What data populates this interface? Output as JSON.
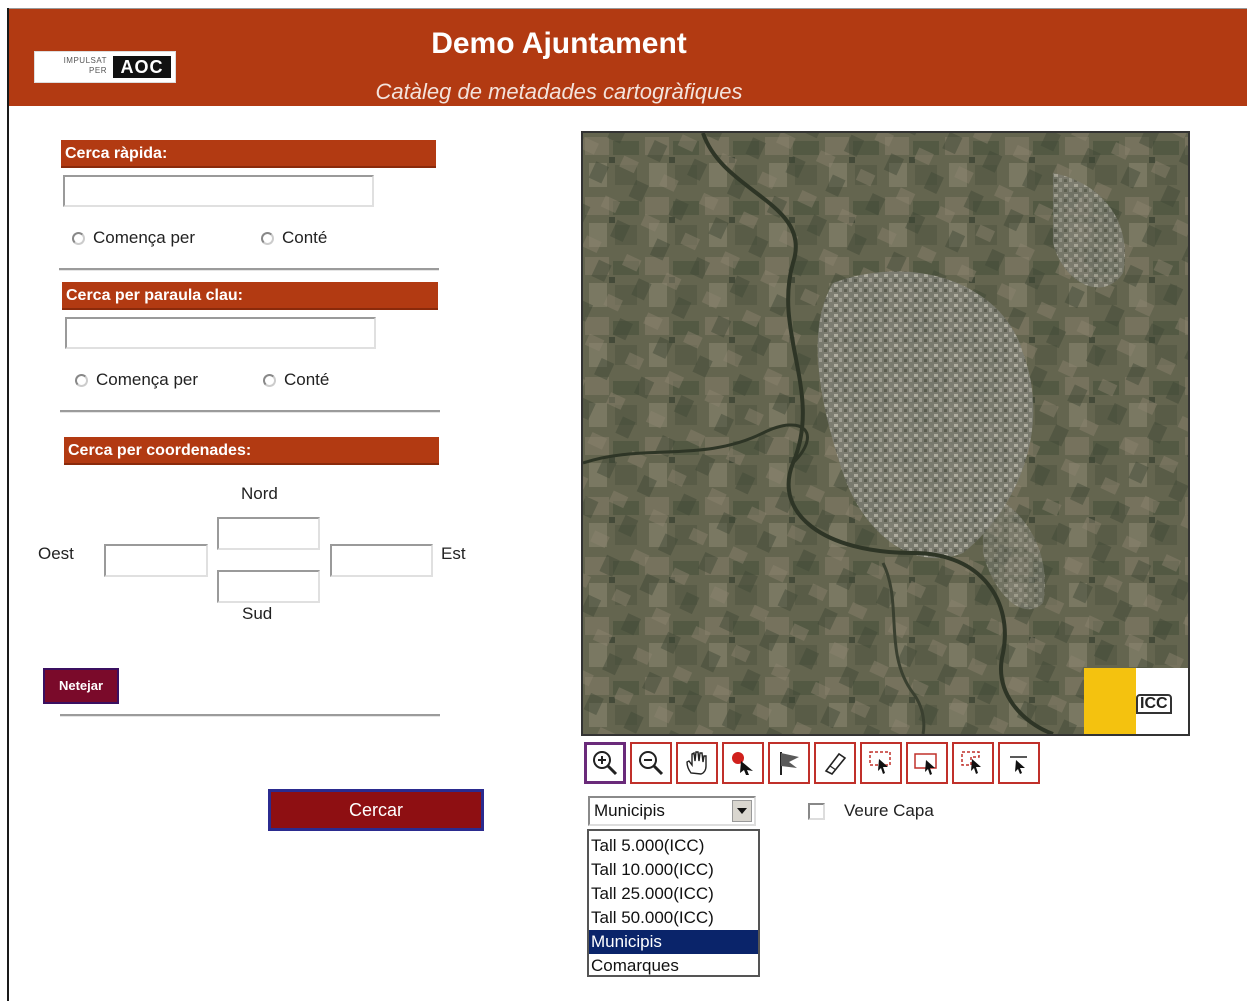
{
  "header": {
    "title": "Demo Ajuntament",
    "subtitle": "Catàleg de metadades cartogràfiques",
    "logo": {
      "small_text_1": "IMPULSAT",
      "small_text_2": "PER",
      "brand": "AOC"
    }
  },
  "quick_search": {
    "heading": "Cerca ràpida:",
    "input_value": "",
    "option_starts": "Comença per",
    "option_contains": "Conté"
  },
  "keyword_search": {
    "heading": "Cerca per paraula clau:",
    "input_value": "",
    "option_starts": "Comença per",
    "option_contains": "Conté"
  },
  "coord_search": {
    "heading": "Cerca per coordenades:",
    "north_label": "Nord",
    "south_label": "Sud",
    "west_label": "Oest",
    "east_label": "Est"
  },
  "buttons": {
    "clear": "Netejar",
    "search": "Cercar"
  },
  "map": {
    "badge_text": "ICC"
  },
  "toolbar": {
    "tools": [
      "zoom-in-icon",
      "zoom-out-icon",
      "pan-hand-icon",
      "pin-point-icon",
      "flag-icon",
      "eraser-icon",
      "select-rect-icon",
      "select-rect-2-icon",
      "select-polygon-icon",
      "pointer-icon"
    ]
  },
  "layer_select": {
    "selected": "Municipis",
    "options": [
      "Tall 5.000(ICC)",
      "Tall 10.000(ICC)",
      "Tall 25.000(ICC)",
      "Tall 50.000(ICC)",
      "Municipis",
      "Comarques"
    ],
    "selected_index": 4
  },
  "show_layer": {
    "label": "Veure Capa",
    "checked": false
  },
  "colors": {
    "brand": "#b23a12",
    "button": "#8e0f12",
    "selection": "#0a246a"
  }
}
